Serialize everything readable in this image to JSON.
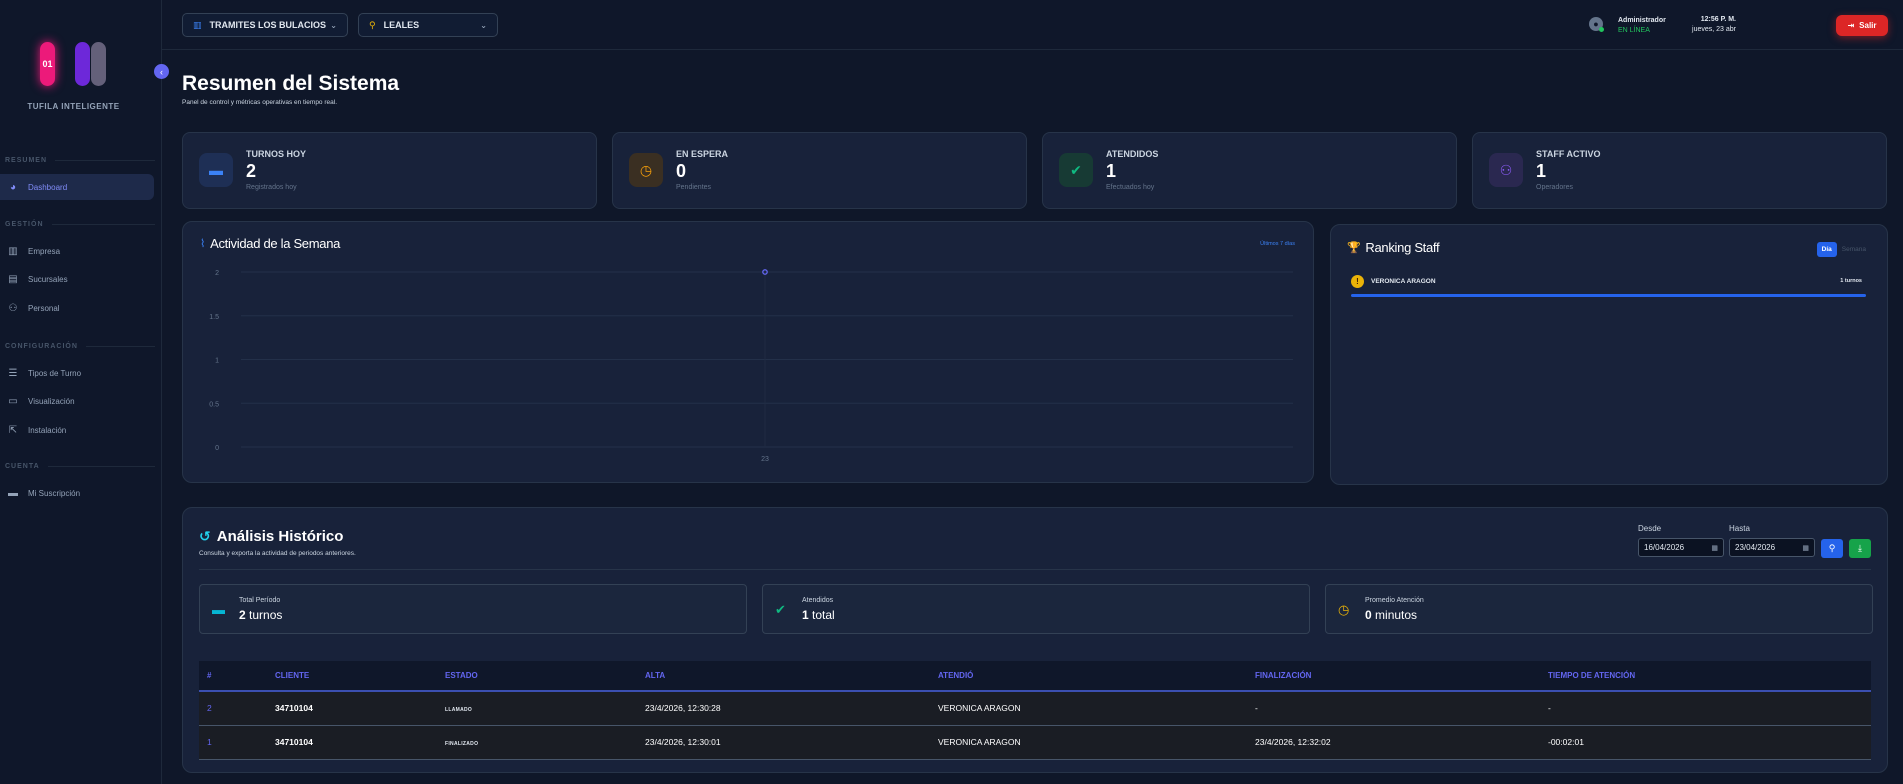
{
  "brand": {
    "logo_text": "01",
    "name": "TUFILA INTELIGENTE"
  },
  "sidebar": {
    "sections": [
      {
        "label": "RESUMEN"
      },
      {
        "label": "GESTIÓN"
      },
      {
        "label": "CONFIGURACIÓN"
      },
      {
        "label": "CUENTA"
      }
    ],
    "items": [
      {
        "label": "Dashboard",
        "icon": "chart-pie-icon",
        "active": true
      },
      {
        "label": "Empresa",
        "icon": "building-icon"
      },
      {
        "label": "Sucursales",
        "icon": "store-icon"
      },
      {
        "label": "Personal",
        "icon": "users-icon"
      },
      {
        "label": "Tipos de Turno",
        "icon": "list-icon"
      },
      {
        "label": "Visualización",
        "icon": "monitor-icon"
      },
      {
        "label": "Instalación",
        "icon": "external-link-icon"
      },
      {
        "label": "Mi Suscripción",
        "icon": "credit-card-icon"
      }
    ]
  },
  "topbar": {
    "company": "TRAMITES LOS BULACIOS",
    "branch": "LEALES",
    "time": "12:56 P. M.",
    "date": "jueves, 23 abr",
    "user_name": "Administrador",
    "user_status": "EN LÍNEA",
    "logout_label": "Salir"
  },
  "header": {
    "title": "Resumen del Sistema",
    "subtitle": "Panel de control y métricas operativas en tiempo real."
  },
  "kpis": [
    {
      "label": "TURNOS HOY",
      "value": "2",
      "sub": "Registrados hoy",
      "icon": "ticket-icon",
      "color": "#3b82f6",
      "bg": "#1e2f55"
    },
    {
      "label": "EN ESPERA",
      "value": "0",
      "sub": "Pendientes",
      "icon": "clock-icon",
      "color": "#f59e0b",
      "bg": "#3a2f22"
    },
    {
      "label": "ATENDIDOS",
      "value": "1",
      "sub": "Efectuados hoy",
      "icon": "check-circle-icon",
      "color": "#10b981",
      "bg": "#173a34"
    },
    {
      "label": "STAFF ACTIVO",
      "value": "1",
      "sub": "Operadores",
      "icon": "users-icon",
      "color": "#8b5cf6",
      "bg": "#2a2850"
    }
  ],
  "activity": {
    "title": "Actividad de la Semana",
    "link": "Últimos 7 días"
  },
  "chart_data": {
    "type": "line",
    "title": "Actividad de la Semana",
    "x": [
      "23"
    ],
    "series": [
      {
        "values": [
          2
        ]
      }
    ],
    "yticks": [
      "2",
      "1.5",
      "1",
      "0.5",
      "0"
    ],
    "ylim": [
      0,
      2
    ],
    "grid": true
  },
  "ranking": {
    "title": "Ranking Staff",
    "toggle_on": "Día",
    "toggle_off": "Semana",
    "rows": [
      {
        "rank": "!",
        "name": "VERONICA ARAGON",
        "count": "1 turnos",
        "fill": 1.0
      }
    ]
  },
  "history": {
    "title": "Análisis Histórico",
    "subtitle": "Consulta y exporta la actividad de periodos anteriores.",
    "from_label": "Desde",
    "from_value": "16/04/2026",
    "to_label": "Hasta",
    "to_value": "23/04/2026",
    "stats": [
      {
        "label": "Total Período",
        "value": "2",
        "unit": "turnos",
        "icon": "ticket-icon",
        "color": "#06b6d4"
      },
      {
        "label": "Atendidos",
        "value": "1",
        "unit": "total",
        "icon": "check-circle-icon",
        "color": "#10b981"
      },
      {
        "label": "Promedio Atención",
        "value": "0",
        "unit": "minutos",
        "icon": "clock-icon",
        "color": "#eab308"
      }
    ],
    "columns": [
      "#",
      "CLIENTE",
      "ESTADO",
      "ALTA",
      "ATENDIÓ",
      "FINALIZACIÓN",
      "TIEMPO DE ATENCIÓN"
    ],
    "rows": [
      [
        "2",
        "34710104",
        "LLAMADO",
        "23/4/2026, 12:30:28",
        "VERONICA ARAGON",
        "-",
        "-"
      ],
      [
        "1",
        "34710104",
        "FINALIZADO",
        "23/4/2026, 12:30:01",
        "VERONICA ARAGON",
        "23/4/2026, 12:32:02",
        "-00:02:01"
      ]
    ]
  }
}
